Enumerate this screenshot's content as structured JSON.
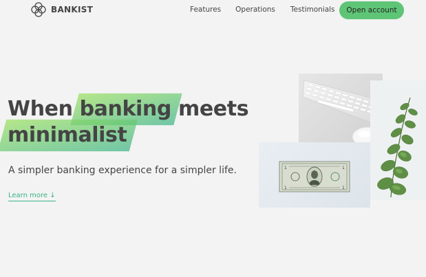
{
  "brand": {
    "name": "BANKIST",
    "logo_icon": "four-rings-logo"
  },
  "nav": {
    "links": [
      "Features",
      "Operations",
      "Testimonials"
    ],
    "cta": "Open account"
  },
  "hero": {
    "title_part1": "When",
    "title_highlight1": "banking",
    "title_part2": "meets",
    "title_highlight2": "minimalist",
    "subtitle": "A simpler banking experience for a simpler life.",
    "learn_more": "Learn more ↓"
  },
  "colors": {
    "accent": "#5ec576",
    "accent_dark": "#39b385",
    "highlight_start": "#9be15d",
    "text": "#444444",
    "background": "#f3f3f3"
  },
  "images": [
    "keyboard-mouse-photo",
    "dollar-bill-photo",
    "eucalyptus-plant-photo"
  ]
}
